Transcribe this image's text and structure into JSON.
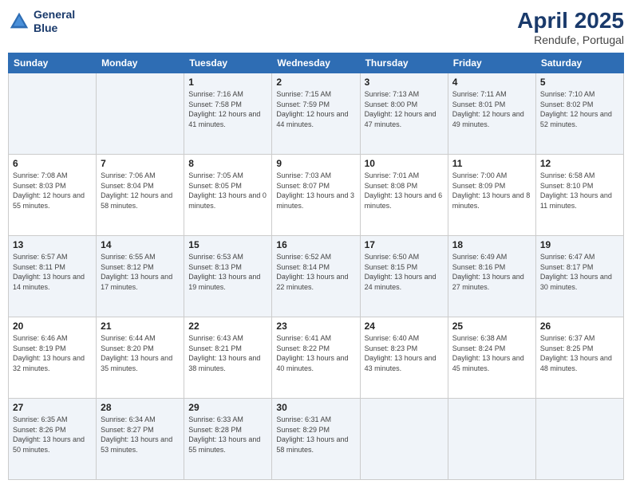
{
  "header": {
    "logo_line1": "General",
    "logo_line2": "Blue",
    "month_year": "April 2025",
    "location": "Rendufe, Portugal"
  },
  "weekdays": [
    "Sunday",
    "Monday",
    "Tuesday",
    "Wednesday",
    "Thursday",
    "Friday",
    "Saturday"
  ],
  "weeks": [
    [
      {
        "day": "",
        "info": ""
      },
      {
        "day": "",
        "info": ""
      },
      {
        "day": "1",
        "info": "Sunrise: 7:16 AM\nSunset: 7:58 PM\nDaylight: 12 hours and 41 minutes."
      },
      {
        "day": "2",
        "info": "Sunrise: 7:15 AM\nSunset: 7:59 PM\nDaylight: 12 hours and 44 minutes."
      },
      {
        "day": "3",
        "info": "Sunrise: 7:13 AM\nSunset: 8:00 PM\nDaylight: 12 hours and 47 minutes."
      },
      {
        "day": "4",
        "info": "Sunrise: 7:11 AM\nSunset: 8:01 PM\nDaylight: 12 hours and 49 minutes."
      },
      {
        "day": "5",
        "info": "Sunrise: 7:10 AM\nSunset: 8:02 PM\nDaylight: 12 hours and 52 minutes."
      }
    ],
    [
      {
        "day": "6",
        "info": "Sunrise: 7:08 AM\nSunset: 8:03 PM\nDaylight: 12 hours and 55 minutes."
      },
      {
        "day": "7",
        "info": "Sunrise: 7:06 AM\nSunset: 8:04 PM\nDaylight: 12 hours and 58 minutes."
      },
      {
        "day": "8",
        "info": "Sunrise: 7:05 AM\nSunset: 8:05 PM\nDaylight: 13 hours and 0 minutes."
      },
      {
        "day": "9",
        "info": "Sunrise: 7:03 AM\nSunset: 8:07 PM\nDaylight: 13 hours and 3 minutes."
      },
      {
        "day": "10",
        "info": "Sunrise: 7:01 AM\nSunset: 8:08 PM\nDaylight: 13 hours and 6 minutes."
      },
      {
        "day": "11",
        "info": "Sunrise: 7:00 AM\nSunset: 8:09 PM\nDaylight: 13 hours and 8 minutes."
      },
      {
        "day": "12",
        "info": "Sunrise: 6:58 AM\nSunset: 8:10 PM\nDaylight: 13 hours and 11 minutes."
      }
    ],
    [
      {
        "day": "13",
        "info": "Sunrise: 6:57 AM\nSunset: 8:11 PM\nDaylight: 13 hours and 14 minutes."
      },
      {
        "day": "14",
        "info": "Sunrise: 6:55 AM\nSunset: 8:12 PM\nDaylight: 13 hours and 17 minutes."
      },
      {
        "day": "15",
        "info": "Sunrise: 6:53 AM\nSunset: 8:13 PM\nDaylight: 13 hours and 19 minutes."
      },
      {
        "day": "16",
        "info": "Sunrise: 6:52 AM\nSunset: 8:14 PM\nDaylight: 13 hours and 22 minutes."
      },
      {
        "day": "17",
        "info": "Sunrise: 6:50 AM\nSunset: 8:15 PM\nDaylight: 13 hours and 24 minutes."
      },
      {
        "day": "18",
        "info": "Sunrise: 6:49 AM\nSunset: 8:16 PM\nDaylight: 13 hours and 27 minutes."
      },
      {
        "day": "19",
        "info": "Sunrise: 6:47 AM\nSunset: 8:17 PM\nDaylight: 13 hours and 30 minutes."
      }
    ],
    [
      {
        "day": "20",
        "info": "Sunrise: 6:46 AM\nSunset: 8:19 PM\nDaylight: 13 hours and 32 minutes."
      },
      {
        "day": "21",
        "info": "Sunrise: 6:44 AM\nSunset: 8:20 PM\nDaylight: 13 hours and 35 minutes."
      },
      {
        "day": "22",
        "info": "Sunrise: 6:43 AM\nSunset: 8:21 PM\nDaylight: 13 hours and 38 minutes."
      },
      {
        "day": "23",
        "info": "Sunrise: 6:41 AM\nSunset: 8:22 PM\nDaylight: 13 hours and 40 minutes."
      },
      {
        "day": "24",
        "info": "Sunrise: 6:40 AM\nSunset: 8:23 PM\nDaylight: 13 hours and 43 minutes."
      },
      {
        "day": "25",
        "info": "Sunrise: 6:38 AM\nSunset: 8:24 PM\nDaylight: 13 hours and 45 minutes."
      },
      {
        "day": "26",
        "info": "Sunrise: 6:37 AM\nSunset: 8:25 PM\nDaylight: 13 hours and 48 minutes."
      }
    ],
    [
      {
        "day": "27",
        "info": "Sunrise: 6:35 AM\nSunset: 8:26 PM\nDaylight: 13 hours and 50 minutes."
      },
      {
        "day": "28",
        "info": "Sunrise: 6:34 AM\nSunset: 8:27 PM\nDaylight: 13 hours and 53 minutes."
      },
      {
        "day": "29",
        "info": "Sunrise: 6:33 AM\nSunset: 8:28 PM\nDaylight: 13 hours and 55 minutes."
      },
      {
        "day": "30",
        "info": "Sunrise: 6:31 AM\nSunset: 8:29 PM\nDaylight: 13 hours and 58 minutes."
      },
      {
        "day": "",
        "info": ""
      },
      {
        "day": "",
        "info": ""
      },
      {
        "day": "",
        "info": ""
      }
    ]
  ]
}
